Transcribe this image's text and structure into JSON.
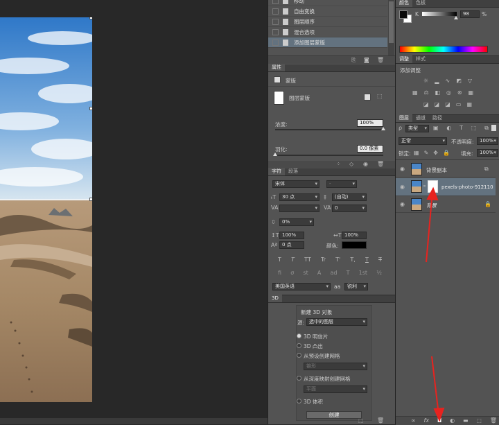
{
  "history": {
    "items": [
      "移动",
      "自由变换",
      "图层顺序",
      "混合选项",
      "添加图层蒙版"
    ],
    "selected_index": 4
  },
  "properties": {
    "tab": "属性",
    "mask_type": "蒙版",
    "layer_mask_label": "图层蒙版",
    "density_label": "浓度:",
    "density_value": "100%",
    "density_level": 1.0,
    "feather_label": "羽化:",
    "feather_value": "0.0 像素",
    "feather_level": 0.0
  },
  "character": {
    "tabs": [
      "字符",
      "段落"
    ],
    "font_family": "宋体",
    "font_style": "-",
    "font_size": "30 点",
    "leading": "(自动)",
    "kerning": "",
    "tracking": "0",
    "vscale_pct": "0%",
    "vertical_scale": "100%",
    "horizontal_scale": "100%",
    "baseline": "0 点",
    "color_label": "颜色:",
    "color": "#000000",
    "style_buttons": [
      "T",
      "T",
      "TT",
      "Tr",
      "T'",
      "T,",
      "T",
      "T"
    ],
    "opentype_buttons": [
      "fi",
      "σ",
      "st",
      "A",
      "ad",
      "T",
      "1st",
      "½"
    ],
    "language": "美国英语",
    "aa_label": "aa",
    "antialias": "锐利"
  },
  "panel_3d": {
    "tab": "3D",
    "title": "新建 3D 对象",
    "source_label": "源:",
    "source_value": "选中的图层",
    "options": [
      "3D 明信片",
      "3D 凸出",
      "从预设创建网格",
      "从深度映射创建网格",
      "3D 体积"
    ],
    "selected_option": 0,
    "preset_value": "锥形",
    "depth_value": "平面",
    "create_button": "创建"
  },
  "color_panel": {
    "tabs": [
      "颜色",
      "色板"
    ],
    "channel_label": "K",
    "value": "98",
    "unit": "%",
    "slider_level": 0.98,
    "foreground": "#0a0a0a",
    "background": "#ffffff"
  },
  "adjustments": {
    "tabs": [
      "调整",
      "样式"
    ],
    "title": "添加调整"
  },
  "layers": {
    "tabs": [
      "图层",
      "通道",
      "路径"
    ],
    "filter_label": "类型",
    "blend_mode": "正常",
    "opacity_label": "不透明度:",
    "opacity_value": "100%",
    "lock_label": "锁定:",
    "fill_label": "填充:",
    "fill_value": "100%",
    "rows": [
      {
        "name": "背景副本"
      },
      {
        "name": "pexels-photo-912110"
      },
      {
        "name": "背景"
      }
    ],
    "bottom_icons": [
      "link-icon",
      "fx-icon",
      "add-mask-icon",
      "adjustment-icon",
      "group-icon",
      "new-layer-icon",
      "trash-icon"
    ]
  },
  "annotations": {
    "arrow_color": "#e8231f"
  }
}
